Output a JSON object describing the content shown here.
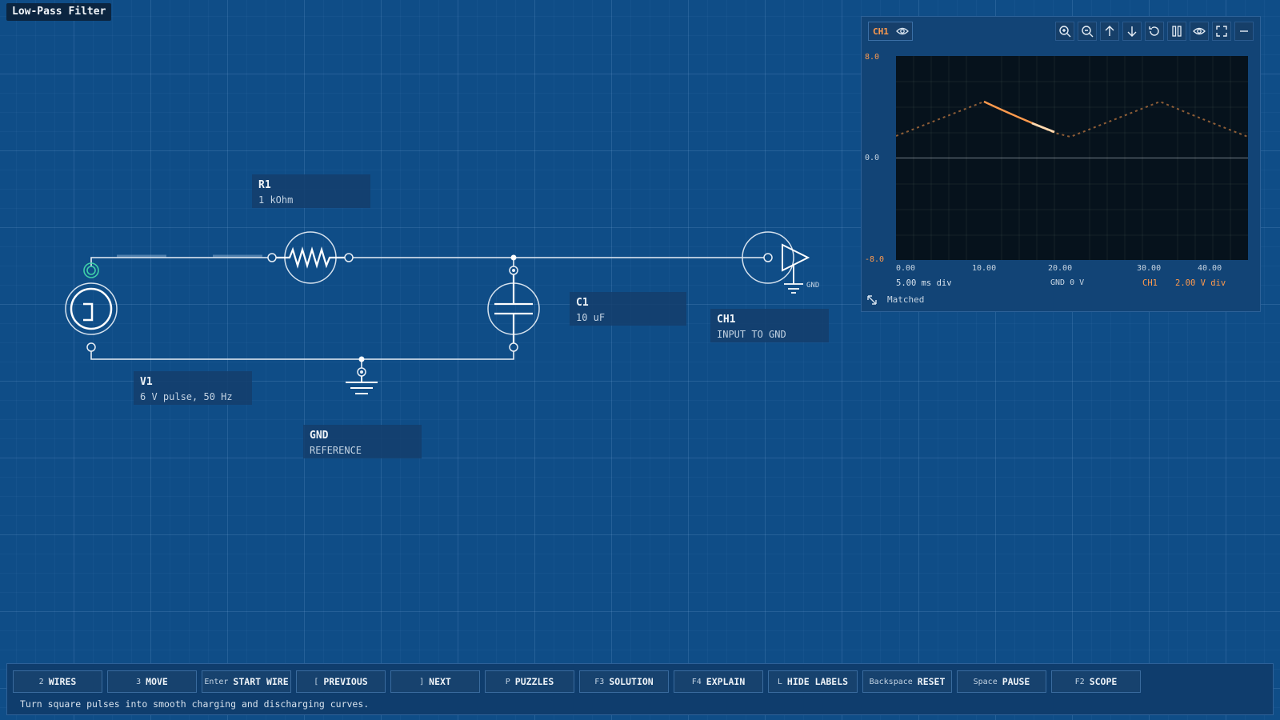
{
  "app": {
    "title": "Low-Pass Filter"
  },
  "components": {
    "r1": {
      "name": "R1",
      "value": "1 kOhm"
    },
    "c1": {
      "name": "C1",
      "value": "10 uF"
    },
    "v1": {
      "name": "V1",
      "value": "6 V pulse, 50 Hz"
    },
    "gnd": {
      "name": "GND",
      "value": "REFERENCE"
    },
    "ch1": {
      "name": "CH1",
      "value": "INPUT TO GND"
    },
    "probe_gnd": "GND"
  },
  "scope": {
    "channel": "CH1",
    "y_top": "8.0",
    "y_mid": "0.0",
    "y_bottom": "-8.0",
    "x_ticks": [
      "0.00",
      "10.00",
      "20.00",
      "30.00",
      "40.00"
    ],
    "timebase": "5.00 ms div",
    "gnd_ref": "GND 0 V",
    "ch_label": "CH1",
    "ch_scale": "2.00 V div",
    "status": "Matched",
    "colors": {
      "trace": "#ff9a4d",
      "background": "#06121c"
    }
  },
  "toolbar": {
    "buttons": [
      {
        "key": "2",
        "label": "WIRES"
      },
      {
        "key": "3",
        "label": "MOVE"
      },
      {
        "key": "Enter",
        "label": "START WIRE"
      },
      {
        "key": "[",
        "label": "PREVIOUS"
      },
      {
        "key": "]",
        "label": "NEXT"
      },
      {
        "key": "P",
        "label": "PUZZLES"
      },
      {
        "key": "F3",
        "label": "SOLUTION"
      },
      {
        "key": "F4",
        "label": "EXPLAIN"
      },
      {
        "key": "L",
        "label": "HIDE LABELS"
      },
      {
        "key": "Backspace",
        "label": "RESET"
      },
      {
        "key": "Space",
        "label": "PAUSE"
      },
      {
        "key": "F2",
        "label": "SCOPE"
      }
    ],
    "hint": "Turn square pulses into smooth charging and discharging curves."
  }
}
